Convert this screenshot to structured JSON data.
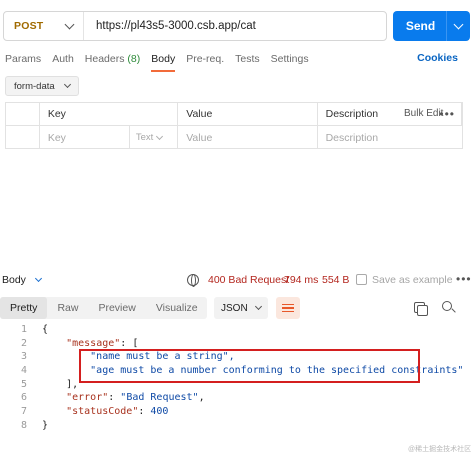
{
  "request": {
    "method": "POST",
    "url": "https://pl43s5-3000.csb.app/cat",
    "send_label": "Send"
  },
  "tabs": [
    {
      "label": "Params"
    },
    {
      "label": "Auth"
    },
    {
      "label": "Headers",
      "count": "(8)"
    },
    {
      "label": "Body",
      "active": true
    },
    {
      "label": "Pre-req."
    },
    {
      "label": "Tests"
    },
    {
      "label": "Settings"
    }
  ],
  "cookies_label": "Cookies",
  "body_mode": "form-data",
  "params_table": {
    "headers": {
      "key": "Key",
      "value": "Value",
      "description": "Description",
      "more": "•••",
      "bulk_edit": "Bulk Edit"
    },
    "placeholder_row": {
      "key": "Key",
      "type": "Text",
      "value": "Value",
      "description": "Description"
    }
  },
  "response": {
    "title": "Body",
    "status": "400 Bad Request",
    "time": "794 ms",
    "size": "554 B",
    "save_example": "Save as example",
    "more": "•••",
    "view_tabs": [
      "Pretty",
      "Raw",
      "Preview",
      "Visualize"
    ],
    "active_view": "Pretty",
    "format": "JSON"
  },
  "code_lines": [
    {
      "n": "1",
      "text": "{"
    },
    {
      "n": "2",
      "text": "    \"message\": ["
    },
    {
      "n": "3",
      "text": "        \"name must be a string\","
    },
    {
      "n": "4",
      "text": "        \"age must be a number conforming to the specified constraints\""
    },
    {
      "n": "5",
      "text": "    ],"
    },
    {
      "n": "6",
      "text": "    \"error\": \"Bad Request\","
    },
    {
      "n": "7",
      "text": "    \"statusCode\": 400"
    },
    {
      "n": "8",
      "text": "}"
    }
  ],
  "watermark": "@稀土掘金技术社区",
  "colors": {
    "accent": "#097bed",
    "tab_underline": "#f26b3a",
    "status_error": "#b3261e",
    "highlight_box": "#d41f1f"
  }
}
